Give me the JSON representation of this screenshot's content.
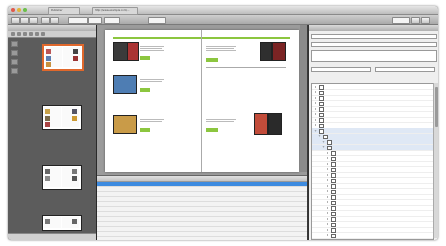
{
  "window": {
    "tabs": [
      "Publisher",
      "http://www.example.com/..."
    ],
    "toolbar_selects": [
      "",
      "",
      "",
      ""
    ],
    "right_toolbar_select": ""
  },
  "left_panel": {
    "title": "",
    "footer": "",
    "thumb_labels": [
      "",
      "",
      "",
      ""
    ]
  },
  "spread": {
    "left_headings": [
      "",
      "",
      ""
    ],
    "right_headings": [
      "",
      ""
    ],
    "watermark": ""
  },
  "table": {
    "headers": [
      "",
      "",
      "",
      "",
      ""
    ],
    "rows": 12,
    "selected_row": 1
  },
  "right_panel": {
    "title": "",
    "controls": [
      "",
      "",
      ""
    ],
    "items": [
      {
        "name": "",
        "col2": "",
        "col3": "",
        "level": 0,
        "open": false
      },
      {
        "name": "",
        "col2": "",
        "col3": "",
        "level": 0,
        "open": false
      },
      {
        "name": "",
        "col2": "",
        "col3": "",
        "level": 0,
        "open": false
      },
      {
        "name": "",
        "col2": "",
        "col3": "",
        "level": 0,
        "open": false
      },
      {
        "name": "",
        "col2": "",
        "col3": "",
        "level": 0,
        "open": false
      },
      {
        "name": "",
        "col2": "",
        "col3": "",
        "level": 0,
        "open": false
      },
      {
        "name": "",
        "col2": "",
        "col3": "",
        "level": 0,
        "open": false
      },
      {
        "name": "",
        "col2": "",
        "col3": "",
        "level": 0,
        "open": false
      },
      {
        "name": "",
        "col2": "",
        "col3": "",
        "level": 0,
        "open": true
      },
      {
        "name": "",
        "col2": "",
        "col3": "",
        "level": 1,
        "open": true
      },
      {
        "name": "",
        "col2": "",
        "col3": "",
        "level": 2,
        "open": true
      },
      {
        "name": "",
        "col2": "",
        "col3": "",
        "level": 2,
        "open": true
      },
      {
        "name": "",
        "col2": "",
        "col3": "",
        "level": 3,
        "open": false
      },
      {
        "name": "",
        "col2": "",
        "col3": "",
        "level": 3,
        "open": false
      },
      {
        "name": "",
        "col2": "",
        "col3": "",
        "level": 3,
        "open": false
      },
      {
        "name": "",
        "col2": "",
        "col3": "",
        "level": 3,
        "open": false
      },
      {
        "name": "",
        "col2": "",
        "col3": "",
        "level": 3,
        "open": false
      },
      {
        "name": "",
        "col2": "",
        "col3": "",
        "level": 3,
        "open": false
      },
      {
        "name": "",
        "col2": "",
        "col3": "",
        "level": 3,
        "open": false
      },
      {
        "name": "",
        "col2": "",
        "col3": "",
        "level": 3,
        "open": false
      },
      {
        "name": "",
        "col2": "",
        "col3": "",
        "level": 3,
        "open": false
      },
      {
        "name": "",
        "col2": "",
        "col3": "",
        "level": 3,
        "open": false
      },
      {
        "name": "",
        "col2": "",
        "col3": "",
        "level": 3,
        "open": false
      },
      {
        "name": "",
        "col2": "",
        "col3": "",
        "level": 3,
        "open": false
      },
      {
        "name": "",
        "col2": "",
        "col3": "",
        "level": 3,
        "open": false
      },
      {
        "name": "",
        "col2": "",
        "col3": "",
        "level": 3,
        "open": false
      },
      {
        "name": "",
        "col2": "",
        "col3": "",
        "level": 3,
        "open": false
      },
      {
        "name": "",
        "col2": "",
        "col3": "",
        "level": 3,
        "open": false
      }
    ]
  },
  "colors": {
    "accent_green": "#8cc63f",
    "selection_orange": "#e0682c",
    "selection_blue": "#3d8be0",
    "watermark_blue": "#8bd2ef"
  }
}
